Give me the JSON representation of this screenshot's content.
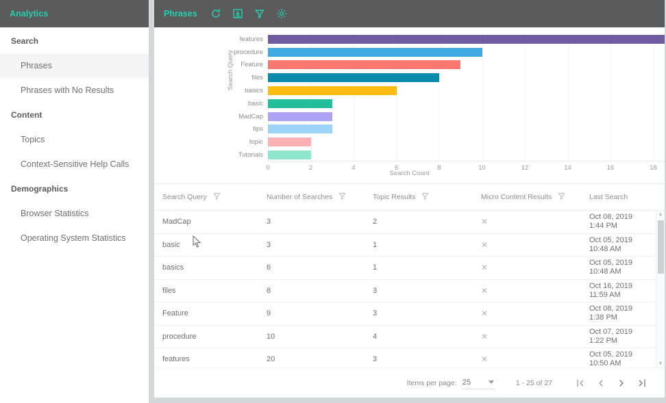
{
  "sidebar": {
    "title": "Analytics",
    "groups": [
      {
        "label": "Search",
        "items": [
          {
            "label": "Phrases",
            "selected": true
          },
          {
            "label": "Phrases with No Results",
            "selected": false
          }
        ]
      },
      {
        "label": "Content",
        "items": [
          {
            "label": "Topics",
            "selected": false
          },
          {
            "label": "Context-Sensitive Help Calls",
            "selected": false
          }
        ]
      },
      {
        "label": "Demographics",
        "items": [
          {
            "label": "Browser Statistics",
            "selected": false
          },
          {
            "label": "Operating System Statistics",
            "selected": false
          }
        ]
      }
    ]
  },
  "toolbar": {
    "title": "Phrases",
    "icons": [
      "refresh-icon",
      "save-icon",
      "filter-icon",
      "settings-icon"
    ]
  },
  "chart_data": {
    "type": "bar",
    "orientation": "horizontal",
    "title": "",
    "xlabel": "Search Count",
    "ylabel": "Search Query",
    "xlim": [
      0,
      20
    ],
    "xticks": [
      0,
      2,
      4,
      6,
      8,
      10,
      12,
      14,
      16,
      18,
      20
    ],
    "grid": true,
    "legend": "none",
    "categories": [
      "features",
      "procedure",
      "Feature",
      "files",
      "basics",
      "basic",
      "MadCap",
      "tips",
      "topic",
      "Tutorials"
    ],
    "values": [
      20,
      10,
      9,
      8,
      6,
      3,
      3,
      3,
      2,
      2
    ],
    "colors": [
      "#6f5ba0",
      "#3fa9e0",
      "#fa7871",
      "#0b8aab",
      "#fbbd12",
      "#23bf9c",
      "#aea2f5",
      "#9ed4f7",
      "#fcb1b4",
      "#8fe6cc"
    ]
  },
  "table": {
    "columns": [
      {
        "label": "Search Query",
        "filter": true
      },
      {
        "label": "Number of Searches",
        "filter": true
      },
      {
        "label": "Topic Results",
        "filter": true
      },
      {
        "label": "Micro Content Results",
        "filter": true
      },
      {
        "label": "Last Search",
        "filter": false
      }
    ],
    "rows": [
      {
        "query": "features",
        "searches": "20",
        "topics": "3",
        "micro": "✕",
        "date": "Oct 05, 2019",
        "time": "10:50 AM"
      },
      {
        "query": "procedure",
        "searches": "10",
        "topics": "4",
        "micro": "✕",
        "date": "Oct 07, 2019",
        "time": "1:22 PM"
      },
      {
        "query": "Feature",
        "searches": "9",
        "topics": "3",
        "micro": "✕",
        "date": "Oct 08, 2019",
        "time": "1:38 PM"
      },
      {
        "query": "files",
        "searches": "8",
        "topics": "3",
        "micro": "✕",
        "date": "Oct 16, 2019",
        "time": "11:59 AM"
      },
      {
        "query": "basics",
        "searches": "6",
        "topics": "1",
        "micro": "✕",
        "date": "Oct 05, 2019",
        "time": "10:48 AM"
      },
      {
        "query": "basic",
        "searches": "3",
        "topics": "1",
        "micro": "✕",
        "date": "Oct 05, 2019",
        "time": "10:48 AM"
      },
      {
        "query": "MadCap",
        "searches": "3",
        "topics": "2",
        "micro": "✕",
        "date": "Oct 08, 2019",
        "time": "1:44 PM"
      }
    ]
  },
  "paginator": {
    "items_per_page_label": "Items per page:",
    "items_per_page_value": "25",
    "range": "1 - 25 of 27",
    "first_label": "|‹",
    "prev_label": "‹",
    "next_label": "›",
    "last_label": "›|"
  },
  "theme": {
    "accent": "#23d0b0",
    "header_bg": "#5b5b5b",
    "page_bg": "#d4d6d8"
  }
}
